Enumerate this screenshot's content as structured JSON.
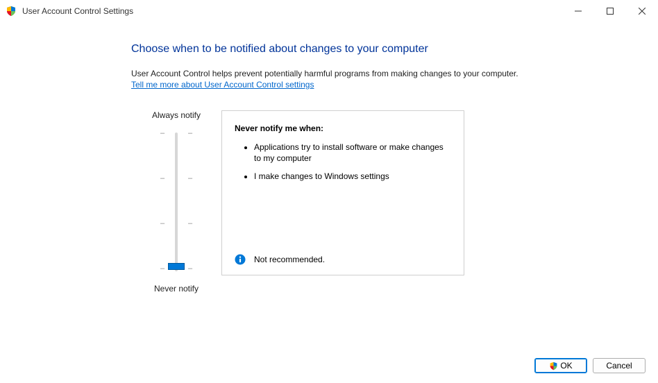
{
  "window": {
    "title": "User Account Control Settings"
  },
  "heading": "Choose when to be notified about changes to your computer",
  "description": "User Account Control helps prevent potentially harmful programs from making changes to your computer.",
  "link": "Tell me more about User Account Control settings",
  "slider": {
    "top_label": "Always notify",
    "bottom_label": "Never notify"
  },
  "panel": {
    "title": "Never notify me when:",
    "bullets": [
      "Applications try to install software or make changes to my computer",
      "I make changes to Windows settings"
    ],
    "warning": "Not recommended."
  },
  "buttons": {
    "ok": "OK",
    "cancel": "Cancel"
  }
}
